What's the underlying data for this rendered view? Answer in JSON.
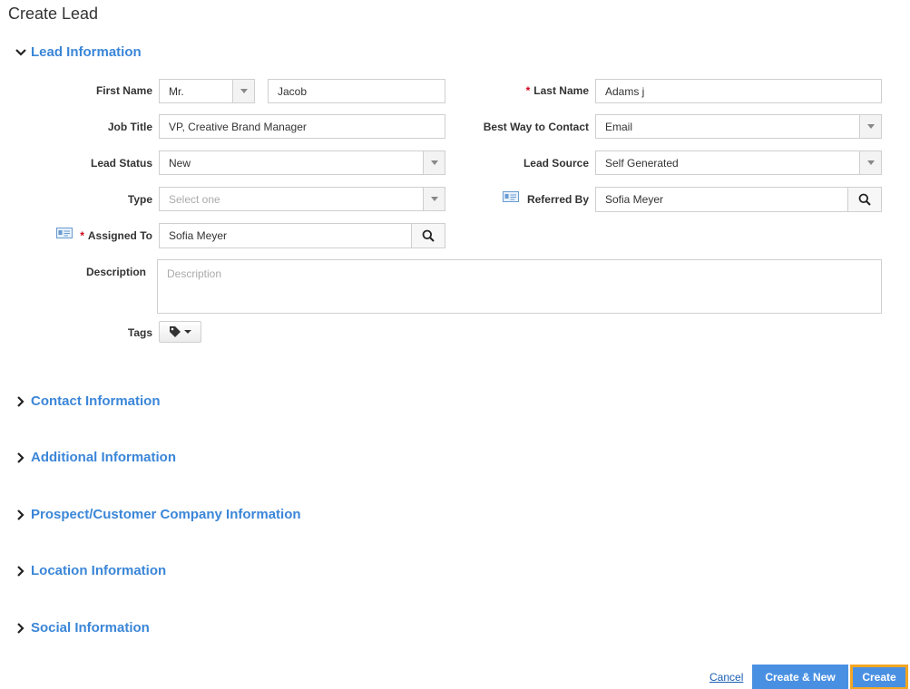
{
  "page": {
    "title": "Create Lead"
  },
  "sections": {
    "lead_information": "Lead Information",
    "contact_information": "Contact Information",
    "additional_information": "Additional Information",
    "company_information": "Prospect/Customer Company Information",
    "location_information": "Location Information",
    "social_information": "Social Information"
  },
  "form": {
    "first_name": {
      "label": "First Name",
      "salutation": "Mr.",
      "value": "Jacob"
    },
    "last_name": {
      "label": "Last Name",
      "value": "Adams j",
      "required_mark": "*"
    },
    "job_title": {
      "label": "Job Title",
      "value": "VP, Creative Brand Manager"
    },
    "best_way": {
      "label": "Best Way to Contact",
      "value": "Email"
    },
    "lead_status": {
      "label": "Lead Status",
      "value": "New"
    },
    "lead_source": {
      "label": "Lead Source",
      "value": "Self Generated"
    },
    "type": {
      "label": "Type",
      "placeholder": "Select one"
    },
    "referred_by": {
      "label": "Referred By",
      "value": "Sofia Meyer"
    },
    "assigned_to": {
      "label": "Assigned To",
      "value": "Sofia Meyer",
      "required_mark": "*"
    },
    "description": {
      "label": "Description",
      "placeholder": "Description"
    },
    "tags": {
      "label": "Tags"
    }
  },
  "actions": {
    "cancel": "Cancel",
    "create_new": "Create & New",
    "create": "Create"
  },
  "colors": {
    "accent": "#3b86d8",
    "primary_button": "#4a90e2",
    "highlight": "#f5a623",
    "required": "#d0021b"
  }
}
